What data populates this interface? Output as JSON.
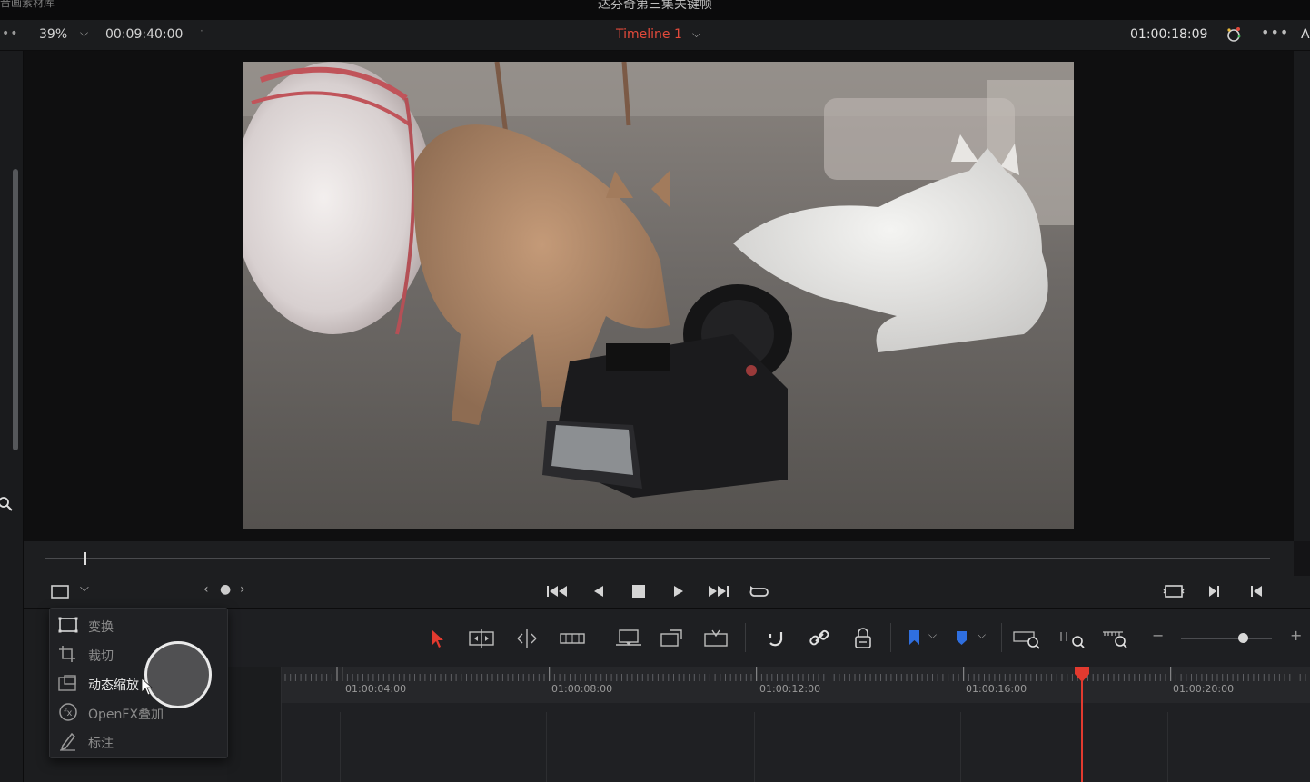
{
  "app": {
    "library_label": "音画素材库",
    "project_title": "达芬奇第三集关键帧"
  },
  "viewer_header": {
    "zoom": "39%",
    "duration_timecode": "00:09:40:00",
    "timeline_name": "Timeline 1",
    "current_timecode": "01:00:18:09",
    "edge_letter": "A"
  },
  "viewer_mode_menu": {
    "items": [
      {
        "label": "变换",
        "icon": "transform-icon"
      },
      {
        "label": "裁切",
        "icon": "crop-icon"
      },
      {
        "label": "动态缩放",
        "icon": "dynamic-zoom-icon"
      },
      {
        "label": "OpenFX叠加",
        "icon": "openfx-icon"
      },
      {
        "label": "标注",
        "icon": "annotation-pen-icon"
      }
    ]
  },
  "ruler": {
    "timecodes": [
      "01:00:04:00",
      "01:00:08:00",
      "01:00:12:00",
      "01:00:16:00",
      "01:00:20:00"
    ]
  },
  "colors": {
    "accent_red": "#e24a3b",
    "marker_blue": "#2f6fe0",
    "flag_blue": "#2f6fe0",
    "background": "#141416"
  }
}
